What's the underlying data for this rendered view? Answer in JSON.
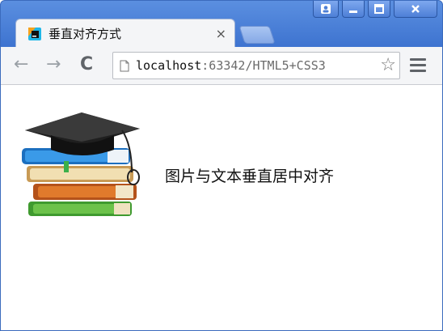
{
  "window": {
    "controls": {
      "user": "user-icon",
      "minimize": "minimize-icon",
      "maximize": "maximize-icon",
      "close": "close-icon"
    }
  },
  "tab": {
    "title": "垂直对齐方式",
    "close_glyph": "×"
  },
  "toolbar": {
    "back_glyph": "←",
    "forward_glyph": "→",
    "reload_glyph": "C",
    "url_host": "localhost",
    "url_rest": ":63342/HTML5+CSS3",
    "star_glyph": "☆"
  },
  "content": {
    "caption": "图片与文本垂直居中对齐"
  },
  "colors": {
    "titlebar": "#3c72cf",
    "toolbar_bg": "#f4f5f7"
  }
}
